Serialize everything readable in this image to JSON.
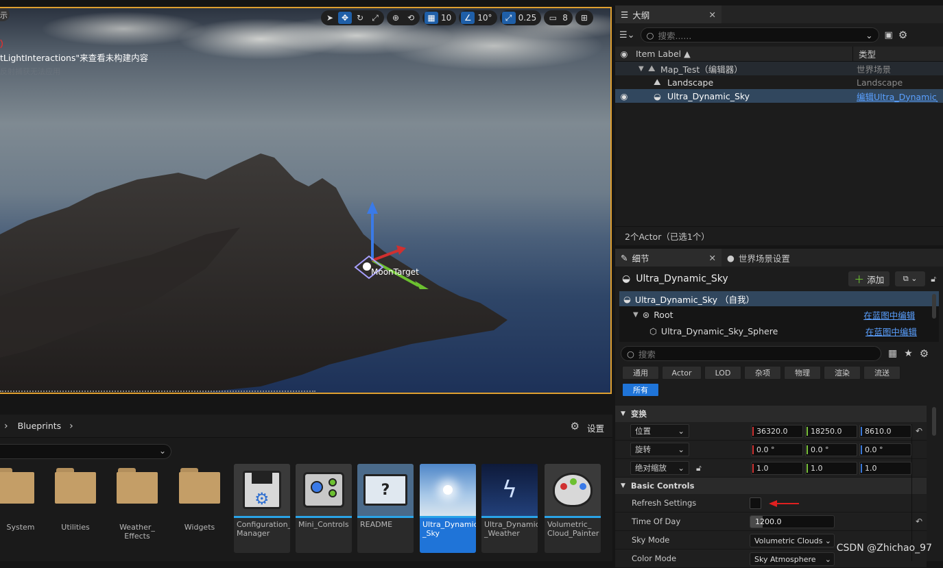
{
  "viewport": {
    "overlay_line1": "）",
    "overlay_line2": "tLightInteractions\"来查看未构建内容",
    "overlay_line3": "反射捕获无法应用",
    "overlay_left_glyph": "示",
    "gizmo_label": "MoonTarget",
    "toolbar": {
      "grid_value": "10",
      "angle_value": "10°",
      "scale_value": "0.25",
      "camera_value": "8"
    }
  },
  "content_browser": {
    "breadcrumb": "Blueprints",
    "settings_label": "设置",
    "folders": [
      "System",
      "Utilities",
      "Weather_\nEffects",
      "Widgets"
    ],
    "assets": [
      {
        "label": "Configuration_\nManager",
        "selected": false
      },
      {
        "label": "Mini_Controls",
        "selected": false
      },
      {
        "label": "README",
        "selected": false
      },
      {
        "label": "Ultra_Dynamic\n_Sky",
        "selected": true
      },
      {
        "label": "Ultra_Dynamic\n_Weather",
        "selected": false
      },
      {
        "label": "Volumetric_\nCloud_Painter",
        "selected": false
      }
    ]
  },
  "outliner": {
    "tab_label": "大纲",
    "search_placeholder": "搜索......",
    "col_label": "Item Label ▲",
    "col_type": "类型",
    "rows": [
      {
        "label": "Map_Test（编辑器）",
        "type": "世界场景"
      },
      {
        "label": "Landscape",
        "type": "Landscape"
      },
      {
        "label": "Ultra_Dynamic_Sky",
        "type": "编辑Ultra_Dynamic_"
      }
    ],
    "status": "2个Actor（已选1个）"
  },
  "details": {
    "tab_label": "细节",
    "tab2_label": "世界场景设置",
    "actor_name": "Ultra_Dynamic_Sky",
    "add_label": "添加",
    "components": [
      {
        "label": "Ultra_Dynamic_Sky （自我）",
        "action": ""
      },
      {
        "label": "Root",
        "action": "在蓝图中编辑"
      },
      {
        "label": "Ultra_Dynamic_Sky_Sphere",
        "action": "在蓝图中编辑"
      }
    ],
    "search_placeholder": "搜索",
    "categories": [
      "通用",
      "Actor",
      "LOD",
      "杂项",
      "物理",
      "渲染",
      "流送"
    ],
    "category_all": "所有",
    "transform_section": "变换",
    "location_label": "位置",
    "rotation_label": "旋转",
    "scale_label": "绝对缩放",
    "location": [
      "36320.0",
      "18250.0",
      "8610.0"
    ],
    "rotation": [
      "0.0 °",
      "0.0 °",
      "0.0 °"
    ],
    "scale": [
      "1.0",
      "1.0",
      "1.0"
    ],
    "basic_section": "Basic Controls",
    "refresh_label": "Refresh Settings",
    "time_label": "Time Of Day",
    "time_value": "1200.0",
    "time_fraction": 0.25,
    "sky_mode_label": "Sky Mode",
    "sky_mode_value": "Volumetric Clouds",
    "color_mode_label": "Color Mode",
    "color_mode_value": "Sky Atmosphere"
  },
  "watermark": "CSDN @Zhichao_97",
  "colors": {
    "accent": "#1f74d8",
    "selection_border": "#e0a030",
    "link": "#5aa0ff",
    "arrow": "#e02020"
  }
}
